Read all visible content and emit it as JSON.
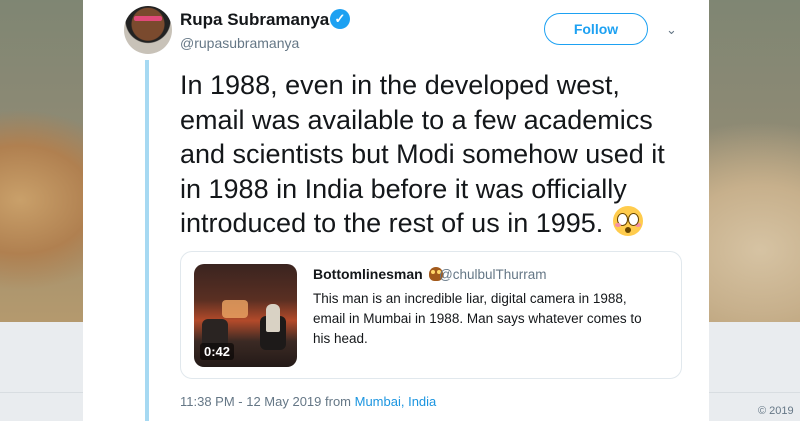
{
  "tweet": {
    "author_name": "Rupa Subramanya",
    "author_handle": "@rupasubramanya",
    "follow_label": "Follow",
    "text": "In 1988, even in the developed west, email was available to a few academics and scientists but Modi somehow used it in 1988 in India before it was officially introduced to the rest of us in 1995.",
    "emoji_icon": "flushed-face-icon",
    "timestamp": "11:38 PM - 12 May 2019 from ",
    "location": "Mumbai, India"
  },
  "quoted_tweet": {
    "author_name": "Bottomlinesman",
    "author_handle": "@chulbulThurram",
    "text": "This man is an incredible liar, digital camera in 1988, email in Mumbai in 1988. Man says whatever comes to his head.",
    "video_duration": "0:42"
  },
  "footer": {
    "copyright": "© 2019"
  },
  "colors": {
    "accent": "#1da1f2",
    "thread_line": "#a6d9f2",
    "muted": "#657786"
  }
}
